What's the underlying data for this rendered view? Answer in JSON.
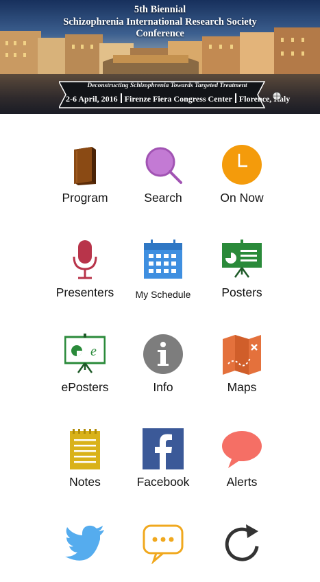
{
  "header": {
    "title_line1": "5th Biennial",
    "title_line2": "Schizophrenia International Research Society",
    "title_line3": "Conference",
    "tagline": "Deconstructing Schizophrenia Towards Targeted Treatment",
    "dates": "2-6 April, 2016",
    "venue": "Firenze Fiera Congress Center",
    "city": "Florence, Italy"
  },
  "menu": [
    {
      "label": "Program",
      "icon": "book-icon"
    },
    {
      "label": "Search",
      "icon": "magnifier-icon"
    },
    {
      "label": "On Now",
      "icon": "clock-icon"
    },
    {
      "label": "Presenters",
      "icon": "microphone-icon"
    },
    {
      "label": "My Schedule",
      "icon": "calendar-icon"
    },
    {
      "label": "Posters",
      "icon": "poster-board-icon"
    },
    {
      "label": "ePosters",
      "icon": "eposter-board-icon"
    },
    {
      "label": "Info",
      "icon": "info-icon"
    },
    {
      "label": "Maps",
      "icon": "map-icon"
    },
    {
      "label": "Notes",
      "icon": "notepad-icon"
    },
    {
      "label": "Facebook",
      "icon": "facebook-icon"
    },
    {
      "label": "Alerts",
      "icon": "speech-bubble-icon"
    },
    {
      "label": "",
      "icon": "twitter-icon"
    },
    {
      "label": "",
      "icon": "chat-dots-icon"
    },
    {
      "label": "",
      "icon": "refresh-icon"
    }
  ],
  "colors": {
    "book": "#7a3e0e",
    "search": "#b86cc8",
    "clock": "#f49b0b",
    "mic": "#b8344a",
    "calendar": "#3f8fe0",
    "poster": "#2a8a3a",
    "info": "#7d7d7d",
    "map": "#e4713c",
    "notes": "#d9b21a",
    "facebook": "#3b5998",
    "alerts": "#f56f65",
    "twitter": "#55acee",
    "chat": "#f0a81e",
    "refresh": "#333333"
  }
}
